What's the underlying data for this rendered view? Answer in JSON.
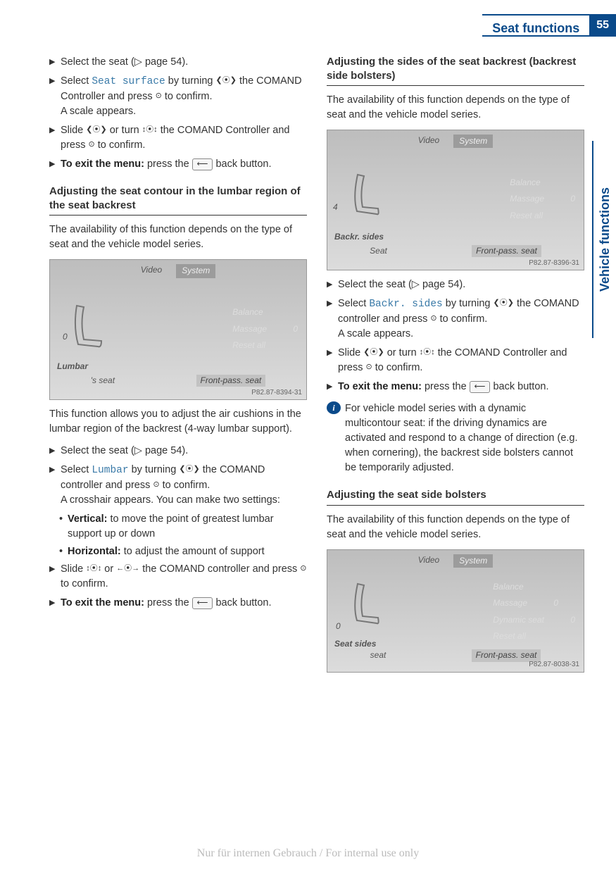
{
  "header": {
    "title": "Seat functions",
    "page": "55"
  },
  "sidetab": "Vehicle functions",
  "watermark": "Nur für internen Gebrauch / For internal use only",
  "icons": {
    "triangle": "▶",
    "back": "⟵",
    "rotary": "⦿",
    "press": "⊙",
    "info": "i",
    "pageref": "▷",
    "dot": "•",
    "slide_h": "❮⦿❯",
    "slide_v": "↕⦿↕",
    "slide_lr": "←⦿→"
  },
  "left": {
    "steps_top": [
      {
        "text_a": "Select the seat (",
        "ref": " page 54",
        "text_b": ")."
      },
      {
        "text_a": "Select ",
        "mono": "Seat surface",
        "text_b": " by turning ",
        "text_c": " the COMAND Controller and press ",
        "text_d": " to confirm.",
        "after": "A scale appears."
      },
      {
        "text_a": "Slide ",
        "text_b": " or turn ",
        "text_c": " the COMAND Controller and press ",
        "text_d": " to confirm."
      },
      {
        "bold": "To exit the menu:",
        "text_a": " press the ",
        "text_b": " back button."
      }
    ],
    "section1": {
      "heading": "Adjusting the seat contour in the lumbar region of the seat backrest",
      "intro": "The availability of this function depends on the type of seat and the vehicle model series.",
      "screenshot": {
        "top": [
          "Video",
          "System"
        ],
        "left_num": "0",
        "left_label": "Lumbar",
        "menu": [
          {
            "label": "Balance",
            "val": ""
          },
          {
            "label": "Massage",
            "val": "0"
          },
          {
            "label": "Reset all",
            "val": ""
          }
        ],
        "bottom": [
          "'s seat",
          "Front-pass. seat"
        ],
        "ref": "P82.87-8394-31"
      },
      "desc": "This function allows you to adjust the air cushions in the lumbar region of the backrest (4-way lumbar support).",
      "steps": [
        {
          "text_a": "Select the seat (",
          "ref": " page 54",
          "text_b": ")."
        },
        {
          "text_a": "Select ",
          "mono": "Lumbar",
          "text_b": " by turning ",
          "text_c": " the COMAND controller and press ",
          "text_d": " to confirm.",
          "after": "A crosshair appears. You can make two settings:"
        }
      ],
      "bullets": [
        {
          "bold": "Vertical:",
          "text": " to move the point of greatest lumbar support up or down"
        },
        {
          "bold": "Horizontal:",
          "text": " to adjust the amount of support"
        }
      ],
      "steps2": [
        {
          "text_a": "Slide ",
          "text_b": " or ",
          "text_c": " the COMAND controller and press ",
          "text_d": " to confirm."
        },
        {
          "bold": "To exit the menu:",
          "text_a": " press the ",
          "text_b": " back button."
        }
      ]
    }
  },
  "right": {
    "section1": {
      "heading": "Adjusting the sides of the seat backrest (backrest side bolsters)",
      "intro": "The availability of this function depends on the type of seat and the vehicle model series.",
      "screenshot": {
        "top": [
          "Video",
          "System"
        ],
        "left_num": "4",
        "left_label": "Backr. sides",
        "menu": [
          {
            "label": "Balance",
            "val": ""
          },
          {
            "label": "Massage",
            "val": "0"
          },
          {
            "label": "Reset all",
            "val": ""
          }
        ],
        "bottom": [
          "Seat",
          "Front-pass. seat"
        ],
        "ref": "P82.87-8396-31"
      },
      "steps": [
        {
          "text_a": "Select the seat (",
          "ref": " page 54",
          "text_b": ")."
        },
        {
          "text_a": "Select ",
          "mono": "Backr. sides",
          "text_b": " by turning ",
          "text_c": " the COMAND controller and press ",
          "text_d": " to confirm.",
          "after": "A scale appears."
        },
        {
          "text_a": "Slide ",
          "text_b": " or turn ",
          "text_c": " the COMAND Controller and press ",
          "text_d": " to confirm."
        },
        {
          "bold": "To exit the menu:",
          "text_a": " press the ",
          "text_b": " back button."
        }
      ],
      "info": "For vehicle model series with a dynamic multicontour seat: if the driving dynamics are activated and respond to a change of direction (e.g. when cornering), the backrest side bolsters cannot be temporarily adjusted."
    },
    "section2": {
      "heading": "Adjusting the seat side bolsters",
      "intro": "The availability of this function depends on the type of seat and the vehicle model series.",
      "screenshot": {
        "top": [
          "Video",
          "System"
        ],
        "left_num": "0",
        "left_label": "Seat sides",
        "menu": [
          {
            "label": "Balance",
            "val": ""
          },
          {
            "label": "Massage",
            "val": "0"
          },
          {
            "label": "Dynamic seat",
            "val": "0"
          },
          {
            "label": "Reset all",
            "val": ""
          }
        ],
        "bottom": [
          "seat",
          "Front-pass. seat"
        ],
        "ref": "P82.87-8038-31"
      }
    }
  }
}
